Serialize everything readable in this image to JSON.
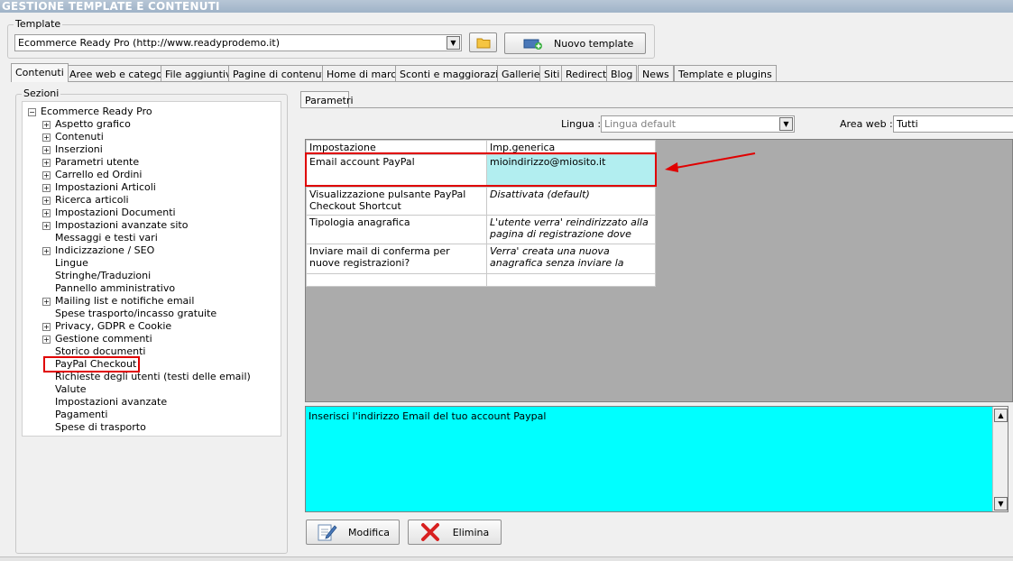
{
  "window": {
    "title": "GESTIONE TEMPLATE E CONTENUTI"
  },
  "template_group": {
    "legend": "Template",
    "selected": "Ecommerce Ready Pro (http://www.readyprodemo.it)",
    "new_template_label": "Nuovo template"
  },
  "tabs": [
    "Contenuti",
    "Aree web e categorie",
    "File aggiuntivi",
    "Pagine di contenuti",
    "Home di marca",
    "Sconti e maggiorazioni",
    "Gallerie",
    "Siti",
    "Redirect",
    "Blog",
    "News",
    "Template e plugins"
  ],
  "sections": {
    "legend": "Sezioni",
    "root": "Ecommerce Ready Pro",
    "items": [
      "Aspetto grafico",
      "Contenuti",
      "Inserzioni",
      "Parametri utente",
      "Carrello ed Ordini",
      "Impostazioni Articoli",
      "Ricerca articoli",
      "Impostazioni Documenti",
      "Impostazioni avanzate sito",
      "Messaggi e testi vari",
      "Indicizzazione / SEO",
      "Lingue",
      "Stringhe/Traduzioni",
      "Pannello amministrativo",
      "Mailing list e notifiche email",
      "Spese trasporto/incasso gratuite",
      "Privacy, GDPR e Cookie",
      "Gestione commenti",
      "Storico documenti",
      "PayPal Checkout",
      "Richieste degli utenti (testi delle email)",
      "Valute",
      "Impostazioni avanzate",
      "Pagamenti",
      "Spese di trasporto"
    ],
    "selected": "PayPal Checkout"
  },
  "parametri": {
    "tab": "Parametri",
    "lingua_label": "Lingua :",
    "lingua_value": "Lingua default",
    "area_label": "Area web :",
    "area_value": "Tutti",
    "columns": [
      "Impostazione",
      "Imp.generica"
    ],
    "rows": [
      {
        "setting": "Email account PayPal",
        "value": "mioindirizzo@miosito.it"
      },
      {
        "setting": "Visualizzazione pulsante PayPal Checkout Shortcut",
        "value": "Disattivata (default)"
      },
      {
        "setting": "Tipologia anagrafica",
        "value": "L'utente verra' reindirizzato alla pagina di registrazione dove specifi..."
      },
      {
        "setting": "Inviare mail di conferma per nuove registrazioni?",
        "value": "Verra' creata una nuova anagrafica senza inviare la conferma per email..."
      }
    ],
    "description": "Inserisci l'indirizzo Email del tuo account Paypal",
    "modifica_label": "Modifica",
    "elimina_label": "Elimina"
  },
  "colors": {
    "highlight": "#e00000",
    "description_bg": "#00ffff",
    "selected_cell_bg": "#b2eef0"
  }
}
